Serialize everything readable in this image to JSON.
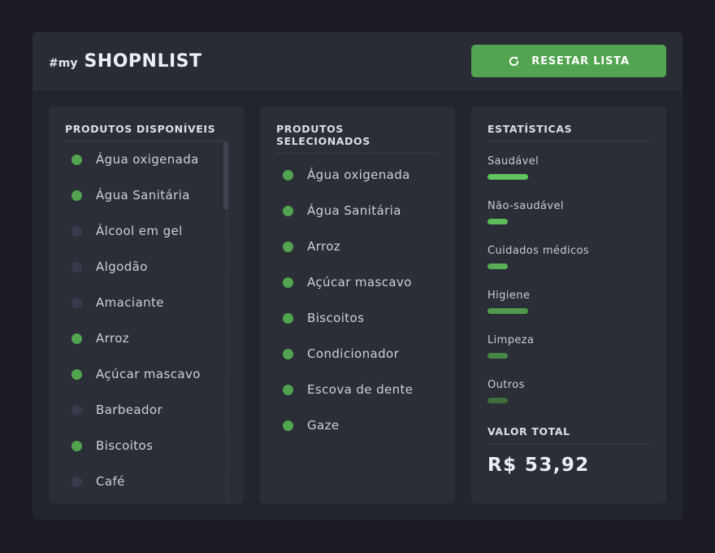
{
  "header": {
    "brand_prefix": "#my",
    "brand_title": "SHOPNLIST",
    "reset_label": "RESETAR LISTA"
  },
  "available": {
    "title": "PRODUTOS DISPONÍVEIS",
    "items": [
      {
        "label": "Água oxigenada",
        "selected": true
      },
      {
        "label": "Água Sanitária",
        "selected": true
      },
      {
        "label": "Álcool em gel",
        "selected": false
      },
      {
        "label": "Algodão",
        "selected": false
      },
      {
        "label": "Amaciante",
        "selected": false
      },
      {
        "label": "Arroz",
        "selected": true
      },
      {
        "label": "Açúcar mascavo",
        "selected": true
      },
      {
        "label": "Barbeador",
        "selected": false
      },
      {
        "label": "Biscoitos",
        "selected": true
      },
      {
        "label": "Café",
        "selected": false
      }
    ]
  },
  "selected": {
    "title": "PRODUTOS SELECIONADOS",
    "items": [
      {
        "label": "Água oxigenada"
      },
      {
        "label": "Água Sanitária"
      },
      {
        "label": "Arroz"
      },
      {
        "label": "Açúcar mascavo"
      },
      {
        "label": "Biscoitos"
      },
      {
        "label": "Condicionador"
      },
      {
        "label": "Escova de dente"
      },
      {
        "label": "Gaze"
      }
    ]
  },
  "stats": {
    "title": "ESTATÍSTICAS",
    "items": [
      {
        "label": "Saudável",
        "value": 2,
        "color": "#63c55f"
      },
      {
        "label": "Não-saudável",
        "value": 1,
        "color": "#5cbd58"
      },
      {
        "label": "Cuidados médicos",
        "value": 1,
        "color": "#58ad55"
      },
      {
        "label": "Higiene",
        "value": 2,
        "color": "#4f9a4c"
      },
      {
        "label": "Limpeza",
        "value": 1,
        "color": "#478545"
      },
      {
        "label": "Outros",
        "value": 1,
        "color": "#3d6e3c"
      }
    ],
    "total_title": "VALOR TOTAL",
    "total_value": "R$ 53,92"
  },
  "colors": {
    "accent": "#52a450",
    "dot_off": "#393b4c"
  }
}
